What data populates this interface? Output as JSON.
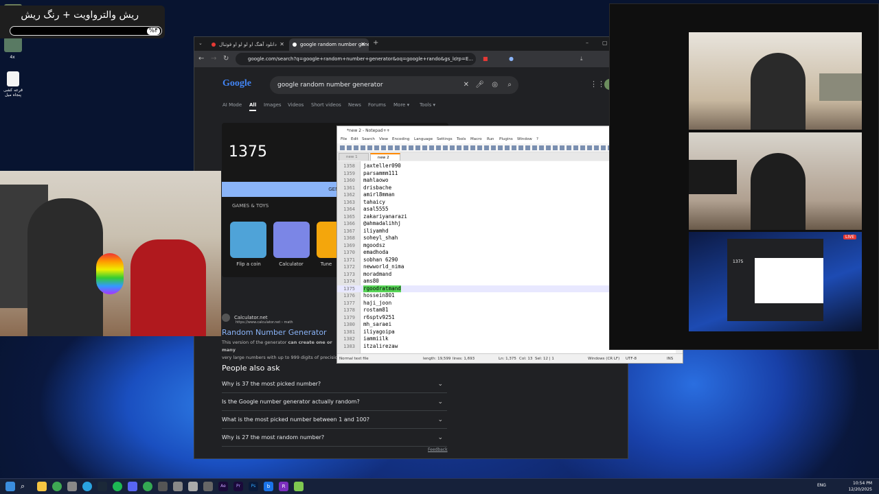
{
  "overlay": {
    "title": "ریش والترواویت + رنگ ریش",
    "percent": "%۴"
  },
  "desktop": {
    "icons": [
      {
        "label": "4x"
      },
      {
        "label": "قرعه کشی پنجاه میل"
      }
    ]
  },
  "chrome": {
    "tabs": [
      {
        "label": "دانلود آهنگ او لو لو او فوتبال",
        "active": false
      },
      {
        "label": "google random number generator",
        "active": true
      }
    ],
    "new_tab": "+",
    "url": "google.com/search?q=google+random+number+generator&oq=google+rando&gs_lcrp=E...",
    "logo": "Google",
    "search_query": "google random number generator",
    "nav_tabs": [
      "AI Mode",
      "All",
      "Images",
      "Videos",
      "Short videos",
      "News",
      "Forums",
      "More ▾",
      "Tools ▾"
    ],
    "active_nav": "All",
    "result_number": "1375",
    "generate_label": "GENE",
    "games_label": "GAMES & TOYS",
    "tiles": [
      {
        "label": "Flip a coin",
        "color": "#4fa3d8"
      },
      {
        "label": "Calculator",
        "color": "#7b86e6"
      },
      {
        "label": "Tune",
        "color": "#f4a60c"
      }
    ],
    "source": {
      "name": "Calculator.net",
      "url": "https://www.calculator.net › math"
    },
    "result_title": "Random Number Generator",
    "result_desc_a": "This version of the generator ",
    "result_desc_b": "can create one or many",
    "result_desc_c": "very large numbers with up to 999 digits of precision.",
    "paa_title": "People also ask",
    "questions": [
      "Why is 37 the most picked number?",
      "Is the Google number generator actually random?",
      "What is the most picked number between 1 and 100?",
      "Why is 27 the most random number?"
    ],
    "feedback": "Feedback"
  },
  "notepad": {
    "title": "*new 2 - Notepad++",
    "menu": [
      "File",
      "Edit",
      "Search",
      "View",
      "Encoding",
      "Language",
      "Settings",
      "Tools",
      "Macro",
      "Run",
      "Plugins",
      "Window",
      "?"
    ],
    "file_tabs": [
      "new 1",
      "new 2"
    ],
    "lines": [
      {
        "n": "1358",
        "t": "jaxteller090"
      },
      {
        "n": "1359",
        "t": "parsammm111"
      },
      {
        "n": "1360",
        "t": "mahlaowo"
      },
      {
        "n": "1361",
        "t": "drisbache"
      },
      {
        "n": "1362",
        "t": "amirl8mman"
      },
      {
        "n": "1363",
        "t": "tahaicy"
      },
      {
        "n": "1364",
        "t": "asal5555"
      },
      {
        "n": "1365",
        "t": "zakariyanarazi"
      },
      {
        "n": "1366",
        "t": "@ahmadalihhj"
      },
      {
        "n": "1367",
        "t": "iliyamhd"
      },
      {
        "n": "1368",
        "t": "soheyl_shah"
      },
      {
        "n": "1369",
        "t": "mgoodsz"
      },
      {
        "n": "1370",
        "t": "emadhoda"
      },
      {
        "n": "1371",
        "t": "sobhan 6290"
      },
      {
        "n": "1372",
        "t": "newworld_nima"
      },
      {
        "n": "1373",
        "t": "moradmand"
      },
      {
        "n": "1374",
        "t": "ams80"
      },
      {
        "n": "1375",
        "t": "rgoodratmand",
        "hl": true
      },
      {
        "n": "1376",
        "t": "hossein801"
      },
      {
        "n": "1377",
        "t": "haji_joon"
      },
      {
        "n": "1378",
        "t": "rostam81"
      },
      {
        "n": "1379",
        "t": "r6sptv9251"
      },
      {
        "n": "1380",
        "t": "mh_saraei"
      },
      {
        "n": "1381",
        "t": "iliyagoipa"
      },
      {
        "n": "1382",
        "t": "iammiilk"
      },
      {
        "n": "1383",
        "t": "itzalirezaw"
      }
    ],
    "status": {
      "type": "Normal text file",
      "length": "length: 19,599",
      "lines": "lines: 1,693",
      "pos": "Ln: 1,375",
      "col": "Col: 13",
      "sel": "Sel: 12 | 1",
      "eol": "Windows (CR LF)",
      "enc": "UTF-8",
      "mode": "INS"
    }
  },
  "pip": {
    "result_number": "1375",
    "live": "LIVE"
  },
  "taskbar": {
    "lang": "ENG",
    "time": "10:54 PM",
    "date": "12/20/2025",
    "app_letters": [
      "Ae",
      "Pr",
      "Ps",
      "b",
      "R"
    ]
  }
}
